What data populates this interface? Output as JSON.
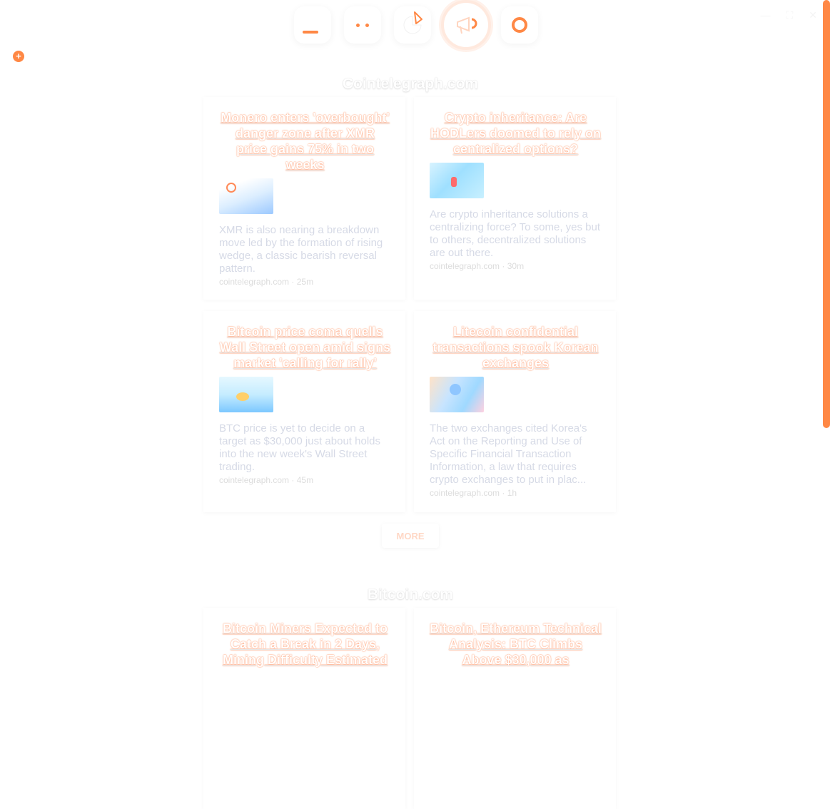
{
  "window": {
    "minimize": "—",
    "maximize": "⛶",
    "close": "✕"
  },
  "nav": {
    "items": [
      {
        "name": "dashboard",
        "icon": "dashboard-icon"
      },
      {
        "name": "markets",
        "icon": "dots-icon"
      },
      {
        "name": "portfolio",
        "icon": "pie-icon"
      },
      {
        "name": "news",
        "icon": "megaphone-icon",
        "active": true
      },
      {
        "name": "settings",
        "icon": "ring-icon"
      }
    ]
  },
  "add_button": "+",
  "sections": [
    {
      "title": "Cointelegraph.com",
      "articles": [
        {
          "title": "Monero enters 'overbought' danger zone after XMR price gains 75% in two weeks",
          "description": "XMR is also nearing a breakdown move led by the formation of rising wedge, a classic bearish reversal pattern.",
          "meta": "cointelegraph.com  ·  25m"
        },
        {
          "title": "Crypto inheritance: Are HODLers doomed to rely on centralized options?",
          "description": "Are crypto inheritance solutions a centralizing force? To some, yes but to others, decentralized solutions are out there.",
          "meta": "cointelegraph.com  ·  30m"
        },
        {
          "title": "Bitcoin price coma quells Wall Street open amid signs market 'calling for rally'",
          "description": "BTC price is yet to decide on a target as $30,000 just about holds into the new week's Wall Street trading.",
          "meta": "cointelegraph.com  ·  45m"
        },
        {
          "title": "Litecoin confidential transactions spook Korean exchanges",
          "description": "The two exchanges cited Korea's Act on the Reporting and Use of Specific Financial Transaction Information, a law that requires crypto exchanges to put in plac...",
          "meta": "cointelegraph.com  ·  1h"
        }
      ],
      "more_label": "MORE"
    },
    {
      "title": "Bitcoin.com",
      "articles": [
        {
          "title": "Bitcoin Miners Expected to Catch a Break in 2 Days, Mining Difficulty Estimated"
        },
        {
          "title": "Bitcoin, Ethereum Technical Analysis: BTC Climbs Above $30,000 as"
        }
      ]
    }
  ]
}
